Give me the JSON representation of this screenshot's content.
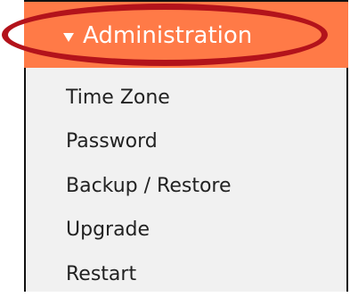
{
  "menu": {
    "header": {
      "title": "Administration",
      "expanded_icon": "triangle-down-icon"
    },
    "items": [
      {
        "label": "Time Zone"
      },
      {
        "label": "Password"
      },
      {
        "label": "Backup / Restore"
      },
      {
        "label": "Upgrade"
      },
      {
        "label": "Restart"
      }
    ]
  },
  "colors": {
    "header_bg": "#ff7a47",
    "highlight_ellipse": "#b3131b",
    "menu_bg": "#f1f1f1",
    "menu_text": "#222222"
  }
}
